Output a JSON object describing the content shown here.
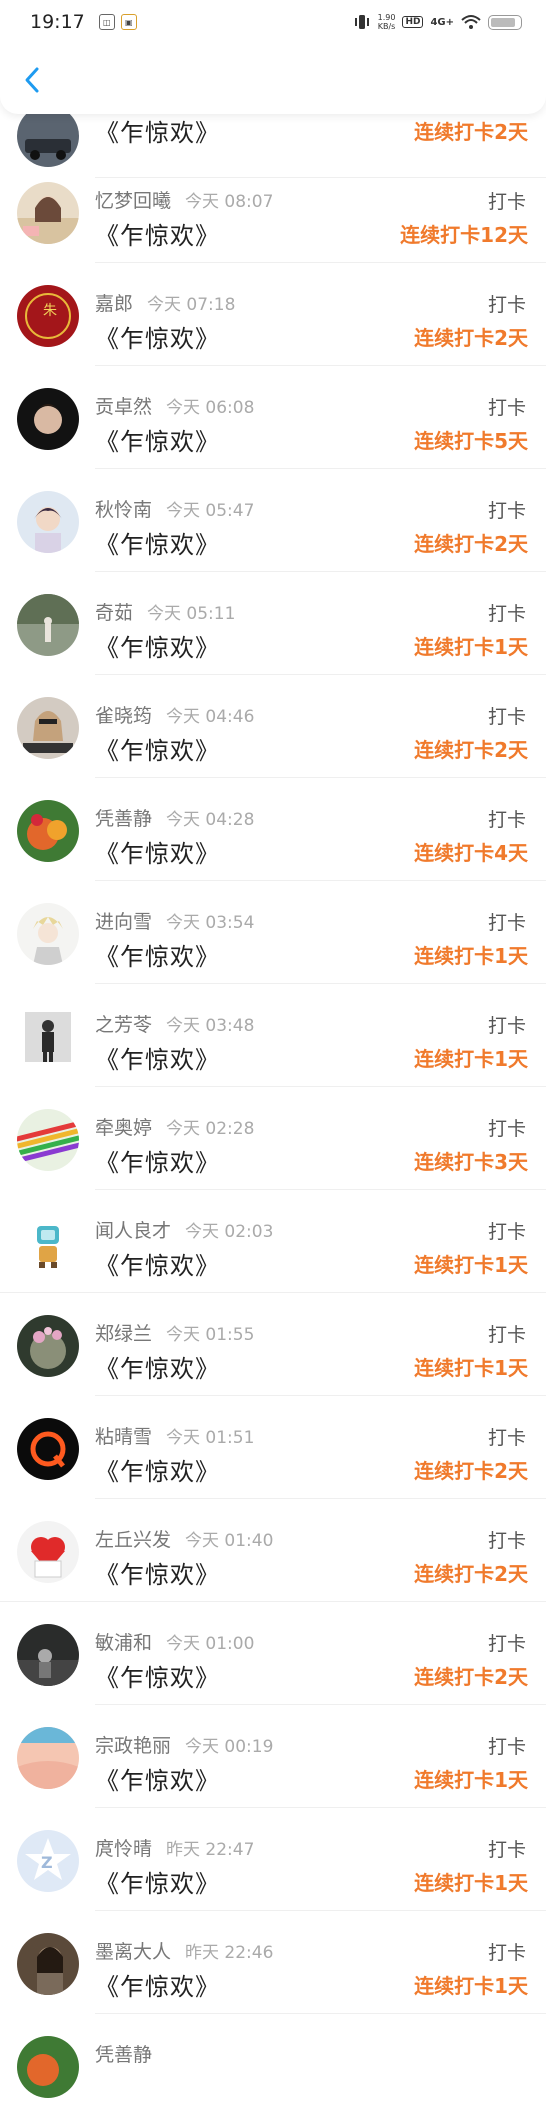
{
  "status_bar": {
    "time": "19:17",
    "net_speed_value": "1.90",
    "net_speed_unit": "KB/s",
    "hd": "HD",
    "signal": "4G+"
  },
  "colors": {
    "accent_orange": "#f07a2c",
    "back_arrow_blue": "#1e9bf0"
  },
  "rows": [
    {
      "name": "",
      "time": "",
      "title": "《乍惊欢》",
      "action": "",
      "streak": "连续打卡2天"
    },
    {
      "name": "忆梦回曦",
      "time": "今天 08:07",
      "title": "《乍惊欢》",
      "action": "打卡",
      "streak": "连续打卡12天"
    },
    {
      "name": "嘉郎",
      "time": "今天 07:18",
      "title": "《乍惊欢》",
      "action": "打卡",
      "streak": "连续打卡2天"
    },
    {
      "name": "贡卓然",
      "time": "今天 06:08",
      "title": "《乍惊欢》",
      "action": "打卡",
      "streak": "连续打卡5天"
    },
    {
      "name": "秋怜南",
      "time": "今天 05:47",
      "title": "《乍惊欢》",
      "action": "打卡",
      "streak": "连续打卡2天"
    },
    {
      "name": "奇茹",
      "time": "今天 05:11",
      "title": "《乍惊欢》",
      "action": "打卡",
      "streak": "连续打卡1天"
    },
    {
      "name": "雀晓筠",
      "time": "今天 04:46",
      "title": "《乍惊欢》",
      "action": "打卡",
      "streak": "连续打卡2天"
    },
    {
      "name": "凭善静",
      "time": "今天 04:28",
      "title": "《乍惊欢》",
      "action": "打卡",
      "streak": "连续打卡4天"
    },
    {
      "name": "进向雪",
      "time": "今天 03:54",
      "title": "《乍惊欢》",
      "action": "打卡",
      "streak": "连续打卡1天"
    },
    {
      "name": "之芳苓",
      "time": "今天 03:48",
      "title": "《乍惊欢》",
      "action": "打卡",
      "streak": "连续打卡1天"
    },
    {
      "name": "牵奥婷",
      "time": "今天 02:28",
      "title": "《乍惊欢》",
      "action": "打卡",
      "streak": "连续打卡3天"
    },
    {
      "name": "闻人良才",
      "time": "今天 02:03",
      "title": "《乍惊欢》",
      "action": "打卡",
      "streak": "连续打卡1天"
    },
    {
      "name": "郑绿兰",
      "time": "今天 01:55",
      "title": "《乍惊欢》",
      "action": "打卡",
      "streak": "连续打卡1天"
    },
    {
      "name": "粘晴雪",
      "time": "今天 01:51",
      "title": "《乍惊欢》",
      "action": "打卡",
      "streak": "连续打卡2天"
    },
    {
      "name": "左丘兴发",
      "time": "今天 01:40",
      "title": "《乍惊欢》",
      "action": "打卡",
      "streak": "连续打卡2天"
    },
    {
      "name": "敏浦和",
      "time": "今天 01:00",
      "title": "《乍惊欢》",
      "action": "打卡",
      "streak": "连续打卡2天"
    },
    {
      "name": "宗政艳丽",
      "time": "今天 00:19",
      "title": "《乍惊欢》",
      "action": "打卡",
      "streak": "连续打卡1天"
    },
    {
      "name": "庹怜晴",
      "time": "昨天 22:47",
      "title": "《乍惊欢》",
      "action": "打卡",
      "streak": "连续打卡1天"
    },
    {
      "name": "墨离大人",
      "time": "昨天 22:46",
      "title": "《乍惊欢》",
      "action": "打卡",
      "streak": "连续打卡1天"
    },
    {
      "name": "凭善静",
      "time": "",
      "title": "",
      "action": "",
      "streak": ""
    }
  ]
}
